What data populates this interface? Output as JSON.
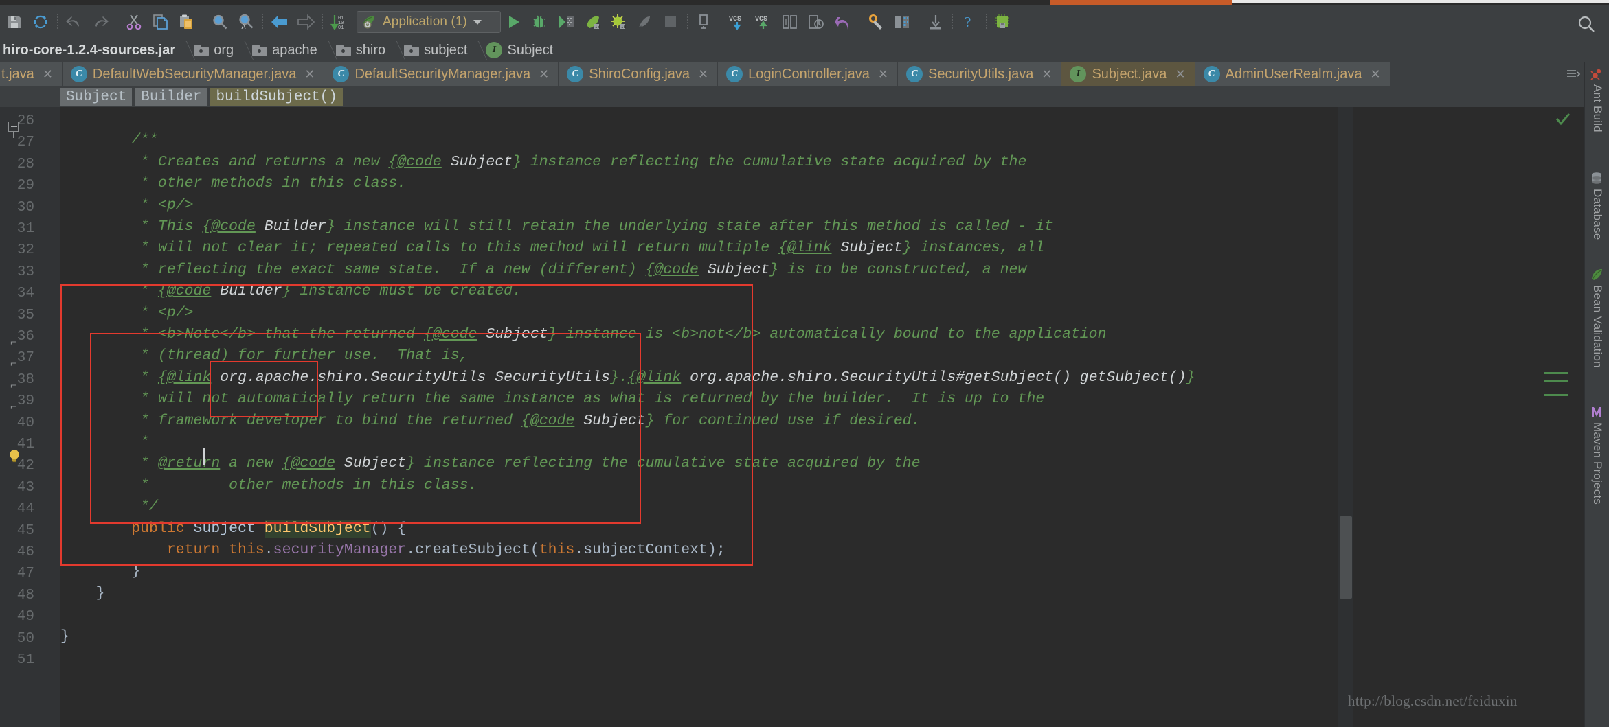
{
  "window": {
    "title_strip_accent": "#c75b28"
  },
  "toolbar": {
    "buttons": [
      {
        "name": "save-all-icon",
        "label": "Save All"
      },
      {
        "name": "synchronize-icon",
        "label": "Synchronize"
      },
      {
        "name": "undo-icon",
        "label": "Undo"
      },
      {
        "name": "redo-icon",
        "label": "Redo"
      },
      {
        "name": "cut-icon",
        "label": "Cut"
      },
      {
        "name": "copy-icon",
        "label": "Copy"
      },
      {
        "name": "paste-icon",
        "label": "Paste"
      },
      {
        "name": "find-icon",
        "label": "Find"
      },
      {
        "name": "replace-icon",
        "label": "Replace"
      },
      {
        "name": "back-icon",
        "label": "Back"
      },
      {
        "name": "forward-icon",
        "label": "Forward"
      },
      {
        "name": "sort-icon",
        "label": "Settings Sync"
      }
    ],
    "run_config": {
      "label": "Application (1)",
      "icon": "application-config-icon"
    },
    "run_buttons": [
      {
        "name": "run-icon",
        "label": "Run"
      },
      {
        "name": "debug-icon",
        "label": "Debug"
      },
      {
        "name": "run-coverage-icon",
        "label": "Run with Coverage"
      },
      {
        "name": "profile-icon",
        "label": "Profile"
      },
      {
        "name": "attach-debug-icon",
        "label": "Attach Debugger"
      },
      {
        "name": "rerun-icon",
        "label": "Rerun"
      },
      {
        "name": "stop-icon",
        "label": "Stop"
      },
      {
        "name": "dump-icon",
        "label": "Thread Dump"
      }
    ],
    "vcs_buttons": [
      {
        "name": "vcs-update-icon",
        "label": "Update Project"
      },
      {
        "name": "vcs-commit-icon",
        "label": "Commit"
      },
      {
        "name": "vcs-diff-icon",
        "label": "Compare with Latest"
      },
      {
        "name": "vcs-history-icon",
        "label": "Show History"
      },
      {
        "name": "vcs-revert-icon",
        "label": "Revert"
      }
    ],
    "misc_buttons": [
      {
        "name": "settings-icon",
        "label": "Settings"
      },
      {
        "name": "project-structure-icon",
        "label": "Project Structure"
      },
      {
        "name": "sdk-icon",
        "label": "SDK Manager"
      },
      {
        "name": "help-icon",
        "label": "Help"
      },
      {
        "name": "memory-icon",
        "label": "Memory Indicator"
      }
    ],
    "search_everywhere": {
      "name": "search-everywhere-icon",
      "label": "Search Everywhere"
    }
  },
  "nav_bar": {
    "crumbs": [
      {
        "label": "hiro-core-1.2.4-sources.jar",
        "icon": "jar-icon",
        "first": true
      },
      {
        "label": "org",
        "icon": "folder-icon"
      },
      {
        "label": "apache",
        "icon": "folder-icon"
      },
      {
        "label": "shiro",
        "icon": "folder-icon"
      },
      {
        "label": "subject",
        "icon": "folder-icon"
      },
      {
        "label": "Subject",
        "icon": "interface-icon"
      }
    ]
  },
  "tabs": [
    {
      "label": "t.java",
      "icon": "none",
      "active": false,
      "truncated": true
    },
    {
      "label": "DefaultWebSecurityManager.java",
      "icon": "class-library-icon",
      "active": false
    },
    {
      "label": "DefaultSecurityManager.java",
      "icon": "class-library-icon",
      "active": false
    },
    {
      "label": "ShiroConfig.java",
      "icon": "class-icon",
      "active": false
    },
    {
      "label": "LoginController.java",
      "icon": "class-icon",
      "active": false
    },
    {
      "label": "SecurityUtils.java",
      "icon": "class-library-icon",
      "active": false
    },
    {
      "label": "Subject.java",
      "icon": "interface-library-icon",
      "active": true
    },
    {
      "label": "AdminUserRealm.java",
      "icon": "class-icon",
      "active": false
    }
  ],
  "structure_breadcrumb": [
    {
      "label": "Subject",
      "current": false
    },
    {
      "label": "Builder",
      "current": false
    },
    {
      "label": "buildSubject()",
      "current": true
    }
  ],
  "editor": {
    "first_line_number": 26,
    "last_line_number": 51,
    "current_line": 45,
    "caret": {
      "line": 45,
      "column": "before buildSubject"
    },
    "line_numbers": [
      26,
      27,
      28,
      29,
      30,
      31,
      32,
      33,
      34,
      35,
      36,
      37,
      38,
      39,
      40,
      41,
      42,
      43,
      44,
      45,
      46,
      47,
      48,
      49,
      50,
      51
    ],
    "lines": [
      {
        "n": 26,
        "tokens": []
      },
      {
        "n": 27,
        "tokens": [
          {
            "t": "        ",
            "c": "pn"
          },
          {
            "t": "/**",
            "c": "jd"
          }
        ]
      },
      {
        "n": 28,
        "tokens": [
          {
            "t": "         * Creates and returns a new ",
            "c": "jd"
          },
          {
            "t": "{@code",
            "c": "jdt"
          },
          {
            "t": " Subject",
            "c": "jdl"
          },
          {
            "t": "} instance reflecting the cumulative state acquired by the",
            "c": "jd"
          }
        ]
      },
      {
        "n": 29,
        "tokens": [
          {
            "t": "         * other methods in this class.",
            "c": "jd"
          }
        ]
      },
      {
        "n": 30,
        "tokens": [
          {
            "t": "         * <p/>",
            "c": "jd"
          }
        ]
      },
      {
        "n": 31,
        "tokens": [
          {
            "t": "         * This ",
            "c": "jd"
          },
          {
            "t": "{@code",
            "c": "jdt"
          },
          {
            "t": " Builder",
            "c": "jdl"
          },
          {
            "t": "} instance will still retain the underlying state after this method is called - it",
            "c": "jd"
          }
        ]
      },
      {
        "n": 32,
        "tokens": [
          {
            "t": "         * will not clear it; repeated calls to this method will return multiple ",
            "c": "jd"
          },
          {
            "t": "{@link",
            "c": "jdt"
          },
          {
            "t": " Subject",
            "c": "jdl"
          },
          {
            "t": "} instances, all",
            "c": "jd"
          }
        ]
      },
      {
        "n": 33,
        "tokens": [
          {
            "t": "         * reflecting the exact same state.  If a new (different) ",
            "c": "jd"
          },
          {
            "t": "{@code",
            "c": "jdt"
          },
          {
            "t": " Subject",
            "c": "jdl"
          },
          {
            "t": "} is to be constructed, a new",
            "c": "jd"
          }
        ]
      },
      {
        "n": 34,
        "tokens": [
          {
            "t": "         * ",
            "c": "jd"
          },
          {
            "t": "{@code",
            "c": "jdt"
          },
          {
            "t": " Builder",
            "c": "jdl"
          },
          {
            "t": "} instance must be created.",
            "c": "jd"
          }
        ]
      },
      {
        "n": 35,
        "tokens": [
          {
            "t": "         * <p/>",
            "c": "jd"
          }
        ]
      },
      {
        "n": 36,
        "tokens": [
          {
            "t": "         * <b>Note</b> that the returned ",
            "c": "jd"
          },
          {
            "t": "{@code",
            "c": "jdt"
          },
          {
            "t": " Subject",
            "c": "jdl"
          },
          {
            "t": "} instance is <b>not</b> automatically bound to the application",
            "c": "jd"
          }
        ]
      },
      {
        "n": 37,
        "tokens": [
          {
            "t": "         * (thread) for further use.  That is,",
            "c": "jd"
          }
        ]
      },
      {
        "n": 38,
        "tokens": [
          {
            "t": "         * ",
            "c": "jd"
          },
          {
            "t": "{@link",
            "c": "jdt"
          },
          {
            "t": " org.apache.shiro.SecurityUtils SecurityUtils",
            "c": "jdl"
          },
          {
            "t": "}.",
            "c": "jd"
          },
          {
            "t": "{@link",
            "c": "jdt"
          },
          {
            "t": " org.apache.shiro.SecurityUtils#getSubject() getSubject()",
            "c": "jdl"
          },
          {
            "t": "}",
            "c": "jd"
          }
        ]
      },
      {
        "n": 39,
        "tokens": [
          {
            "t": "         * will not automatically return the same instance as what is returned by the builder.  It is up to the",
            "c": "jd"
          }
        ]
      },
      {
        "n": 40,
        "tokens": [
          {
            "t": "         * framework developer to bind the returned ",
            "c": "jd"
          },
          {
            "t": "{@code",
            "c": "jdt"
          },
          {
            "t": " Subject",
            "c": "jdl"
          },
          {
            "t": "} for continued use if desired.",
            "c": "jd"
          }
        ]
      },
      {
        "n": 41,
        "tokens": [
          {
            "t": "         *",
            "c": "jd"
          }
        ]
      },
      {
        "n": 42,
        "tokens": [
          {
            "t": "         * ",
            "c": "jd"
          },
          {
            "t": "@return",
            "c": "jdt"
          },
          {
            "t": " a new ",
            "c": "jd"
          },
          {
            "t": "{@code",
            "c": "jdt"
          },
          {
            "t": " Subject",
            "c": "jdl"
          },
          {
            "t": "} instance reflecting the cumulative state acquired by the",
            "c": "jd"
          }
        ]
      },
      {
        "n": 43,
        "tokens": [
          {
            "t": "         *         other methods in this class.",
            "c": "jd"
          }
        ]
      },
      {
        "n": 44,
        "tokens": [
          {
            "t": "         */",
            "c": "jd"
          }
        ]
      },
      {
        "n": 45,
        "tokens": [
          {
            "t": "        ",
            "c": "pn"
          },
          {
            "t": "public",
            "c": "kw"
          },
          {
            "t": " ",
            "c": "pn"
          },
          {
            "t": "Subject",
            "c": "typ"
          },
          {
            "t": " ",
            "c": "pn"
          },
          {
            "t": "buildSubject",
            "c": "mth-hl-mth"
          },
          {
            "t": "() {",
            "c": "pn"
          }
        ]
      },
      {
        "n": 46,
        "tokens": [
          {
            "t": "            ",
            "c": "pn"
          },
          {
            "t": "return",
            "c": "kw"
          },
          {
            "t": " ",
            "c": "pn"
          },
          {
            "t": "this",
            "c": "kw"
          },
          {
            "t": ".",
            "c": "pn"
          },
          {
            "t": "securityManager",
            "c": "fld"
          },
          {
            "t": ".createSubject(",
            "c": "pn"
          },
          {
            "t": "this",
            "c": "kw"
          },
          {
            "t": ".",
            "c": "pn"
          },
          {
            "t": "subjectContext",
            "c": "pn"
          },
          {
            "t": ");",
            "c": "pn"
          }
        ]
      },
      {
        "n": 47,
        "tokens": [
          {
            "t": "        }",
            "c": "pn"
          }
        ]
      },
      {
        "n": 48,
        "tokens": [
          {
            "t": "    }",
            "c": "pn"
          }
        ]
      },
      {
        "n": 49,
        "tokens": []
      },
      {
        "n": 50,
        "tokens": [
          {
            "t": "}",
            "c": "pn"
          }
        ]
      },
      {
        "n": 51,
        "tokens": []
      }
    ],
    "annotations": {
      "name": "red-highlight-rectangles",
      "count": 3,
      "color": "#e33a2e"
    },
    "gutter": {
      "intention_bulb": {
        "line": 45,
        "name": "intention-bulb-icon"
      },
      "fold_regions": [
        27,
        45,
        47,
        48
      ]
    }
  },
  "watermark": {
    "text": "http://blog.csdn.net/feiduxin"
  },
  "tool_rail": [
    {
      "label": "Ant Build",
      "icon": "ant-icon"
    },
    {
      "label": "Database",
      "icon": "database-icon"
    },
    {
      "label": "Bean Validation",
      "icon": "bean-validation-icon"
    },
    {
      "label": "Maven Projects",
      "icon": "maven-icon"
    }
  ],
  "inspections": {
    "status": "ok",
    "icon": "inspection-ok-icon"
  },
  "colors": {
    "editor_bg": "#2b2b2b",
    "chrome_bg": "#3c3f41",
    "gutter_bg": "#313335",
    "javadoc_green": "#629755",
    "keyword_orange": "#cc7832",
    "method_yellow": "#ffc66d",
    "field_purple": "#9876aa",
    "type_blue": "#b4c5d8",
    "tab_active": "#5d5640",
    "annotation_red": "#e33a2e"
  }
}
